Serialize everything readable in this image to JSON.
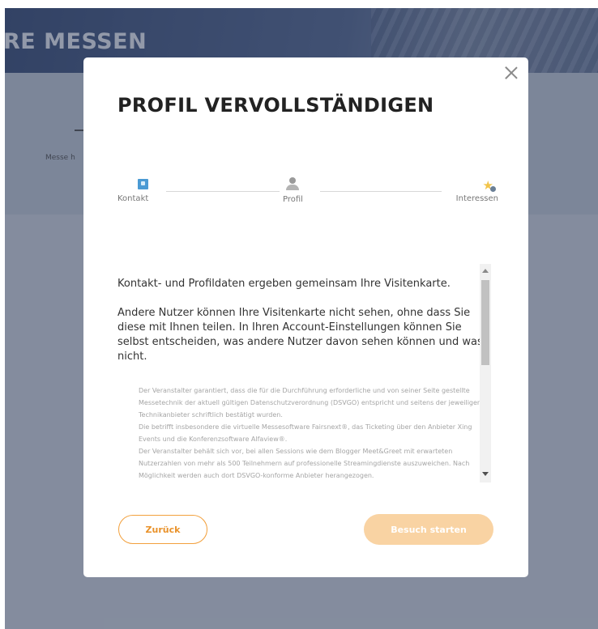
{
  "background": {
    "heading": "RE MESSEN",
    "small_text": "Messe h"
  },
  "modal": {
    "title": "PROFIL VERVOLLSTÄNDIGEN",
    "steps": [
      {
        "label": "Kontakt",
        "icon": "contact-card-icon"
      },
      {
        "label": "Profil",
        "icon": "user-icon"
      },
      {
        "label": "Interessen",
        "icon": "star-icon"
      }
    ],
    "intro": "Kontakt- und Profildaten ergeben gemeinsam Ihre Visitenkarte.",
    "info": "Andere Nutzer können Ihre Visitenkarte nicht sehen, ohne dass Sie diese mit Ihnen teilen. In Ihren Account-Einstellungen können Sie selbst entscheiden, was andere Nutzer davon sehen können und was nicht.",
    "legal": [
      "Der Veranstalter garantiert, dass die für die Durchführung erforderliche und von seiner Seite gestellte Messetechnik der aktuell gültigen Datenschutzverordnung (DSVGO) entspricht und seitens der jeweiligen Technikanbieter schriftlich bestätigt wurden.",
      "Die betrifft insbesondere die virtuelle Messesoftware Fairsnext®, das Ticketing über den Anbieter Xing Events und die Konferenzsoftware Alfaview®.",
      "Der Veranstalter behält sich vor, bei allen Sessions wie dem Blogger Meet&Greet mit erwarteten Nutzerzahlen von mehr als 500 Teilnehmern auf professionelle Streamingdienste auszuweichen. Nach Möglichkeit werden auch dort DSVGO-konforme Anbieter herangezogen."
    ],
    "buttons": {
      "back": "Zurück",
      "start": "Besuch starten"
    },
    "colors": {
      "accent": "#f2a03d",
      "accent_disabled": "#f9d3a3",
      "step_active": "#4a9ad4"
    }
  }
}
